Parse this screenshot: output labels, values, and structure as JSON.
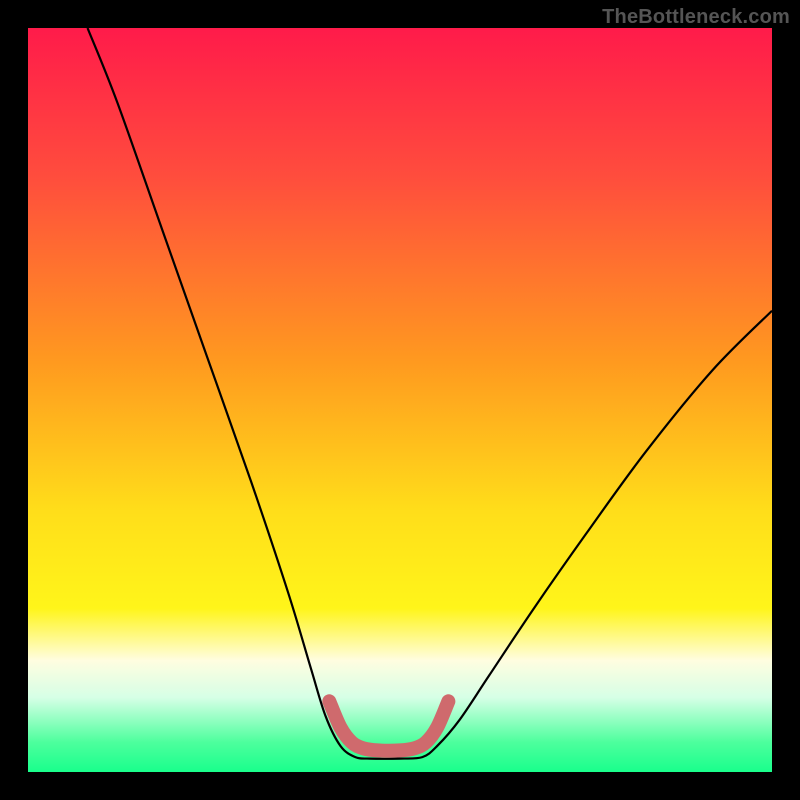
{
  "watermark": "TheBottleneck.com",
  "chart_data": {
    "type": "line",
    "title": "",
    "xlabel": "",
    "ylabel": "",
    "xlim": [
      0,
      100
    ],
    "ylim": [
      0,
      100
    ],
    "gradient_stops": [
      {
        "offset": 0.0,
        "color": "#ff1b4a"
      },
      {
        "offset": 0.2,
        "color": "#ff4d3d"
      },
      {
        "offset": 0.45,
        "color": "#ff9a1f"
      },
      {
        "offset": 0.65,
        "color": "#ffde1a"
      },
      {
        "offset": 0.78,
        "color": "#fff51a"
      },
      {
        "offset": 0.85,
        "color": "#fffde0"
      },
      {
        "offset": 0.9,
        "color": "#d6ffe6"
      },
      {
        "offset": 0.96,
        "color": "#4dff9d"
      },
      {
        "offset": 1.0,
        "color": "#19ff8c"
      }
    ],
    "series": [
      {
        "name": "v-curve",
        "stroke": "#000000",
        "points": [
          {
            "x": 8.0,
            "y": 100.0
          },
          {
            "x": 12.0,
            "y": 90.0
          },
          {
            "x": 18.0,
            "y": 73.0
          },
          {
            "x": 24.0,
            "y": 56.0
          },
          {
            "x": 30.0,
            "y": 39.0
          },
          {
            "x": 35.0,
            "y": 24.0
          },
          {
            "x": 38.0,
            "y": 14.0
          },
          {
            "x": 40.0,
            "y": 7.5
          },
          {
            "x": 42.0,
            "y": 3.5
          },
          {
            "x": 44.0,
            "y": 2.0
          },
          {
            "x": 46.0,
            "y": 1.8
          },
          {
            "x": 50.0,
            "y": 1.8
          },
          {
            "x": 53.0,
            "y": 2.0
          },
          {
            "x": 55.0,
            "y": 3.5
          },
          {
            "x": 58.0,
            "y": 7.0
          },
          {
            "x": 62.0,
            "y": 13.0
          },
          {
            "x": 68.0,
            "y": 22.0
          },
          {
            "x": 75.0,
            "y": 32.0
          },
          {
            "x": 83.0,
            "y": 43.0
          },
          {
            "x": 92.0,
            "y": 54.0
          },
          {
            "x": 100.0,
            "y": 62.0
          }
        ]
      },
      {
        "name": "valley-highlight",
        "stroke": "#cf6a6d",
        "points": [
          {
            "x": 40.5,
            "y": 9.5
          },
          {
            "x": 42.0,
            "y": 6.0
          },
          {
            "x": 43.5,
            "y": 4.0
          },
          {
            "x": 45.0,
            "y": 3.2
          },
          {
            "x": 47.0,
            "y": 2.9
          },
          {
            "x": 50.0,
            "y": 2.9
          },
          {
            "x": 52.0,
            "y": 3.2
          },
          {
            "x": 53.5,
            "y": 4.0
          },
          {
            "x": 55.0,
            "y": 6.0
          },
          {
            "x": 56.5,
            "y": 9.5
          }
        ]
      }
    ]
  }
}
